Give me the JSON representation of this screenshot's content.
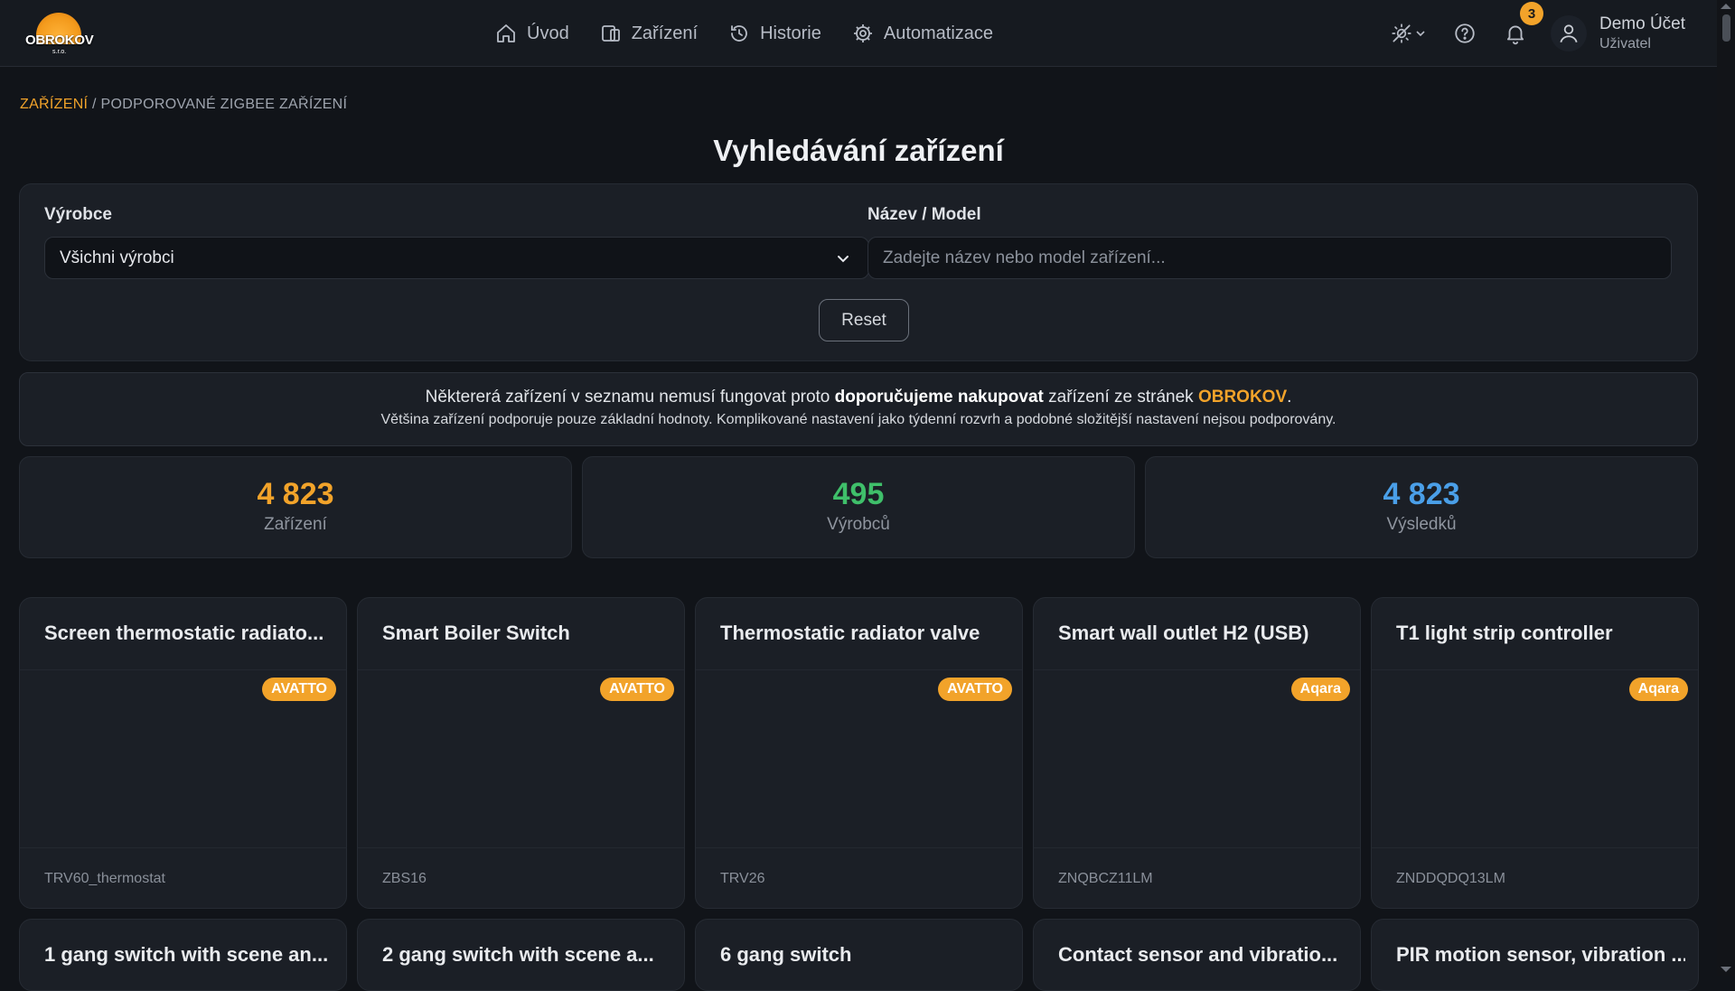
{
  "app": {
    "logo_text": "OBROKOV",
    "logo_sub": "s.r.o."
  },
  "nav": [
    {
      "label": "Úvod",
      "icon": "home-icon"
    },
    {
      "label": "Zařízení",
      "icon": "devices-icon"
    },
    {
      "label": "Historie",
      "icon": "history-icon"
    },
    {
      "label": "Automatizace",
      "icon": "gear-icon"
    }
  ],
  "header": {
    "notifications_count": "3",
    "user_name": "Demo Účet",
    "user_role": "Uživatel"
  },
  "breadcrumb": {
    "root": "ZAŘÍZENÍ",
    "separator": " / ",
    "current": "PODPOROVANÉ ZIGBEE ZAŘÍZENÍ"
  },
  "page_title": "Vyhledávání zařízení",
  "filters": {
    "manufacturer_label": "Výrobce",
    "manufacturer_value": "Všichni výrobci",
    "name_label": "Název / Model",
    "name_placeholder": "Zadejte název nebo model zařízení...",
    "reset_label": "Reset"
  },
  "notice": {
    "part1": "Některerá zařízení v seznamu nemusí fungovat proto ",
    "bold": "doporučujeme nakupovat",
    "part2": " zařízení ze stránek ",
    "brand": "OBROKOV",
    "part3": ".",
    "line2": "Většina zařízení podporuje pouze základní hodnoty. Komplikované nastavení jako týdenní rozvrh a podobné složitější nastavení nejsou podporovány."
  },
  "stats": [
    {
      "value": "4 823",
      "label": "Zařízení",
      "color": "#f2a32a"
    },
    {
      "value": "495",
      "label": "Výrobců",
      "color": "#3fbf6a"
    },
    {
      "value": "4 823",
      "label": "Výsledků",
      "color": "#4a9fe8"
    }
  ],
  "devices": [
    {
      "title": "Screen thermostatic radiato...",
      "brand": "AVATTO",
      "model": "TRV60_thermostat"
    },
    {
      "title": "Smart Boiler Switch",
      "brand": "AVATTO",
      "model": "ZBS16"
    },
    {
      "title": "Thermostatic radiator valve",
      "brand": "AVATTO",
      "model": "TRV26"
    },
    {
      "title": "Smart wall outlet H2 (USB)",
      "brand": "Aqara",
      "model": "ZNQBCZ11LM"
    },
    {
      "title": "T1 light strip controller",
      "brand": "Aqara",
      "model": "ZNDDQDQ13LM"
    },
    {
      "title": "1 gang switch with scene an...",
      "brand": "",
      "model": ""
    },
    {
      "title": "2 gang switch with scene a...",
      "brand": "",
      "model": ""
    },
    {
      "title": "6 gang switch",
      "brand": "",
      "model": ""
    },
    {
      "title": "Contact sensor and vibratio...",
      "brand": "",
      "model": ""
    },
    {
      "title": "PIR motion sensor, vibration ...",
      "brand": "",
      "model": ""
    }
  ]
}
